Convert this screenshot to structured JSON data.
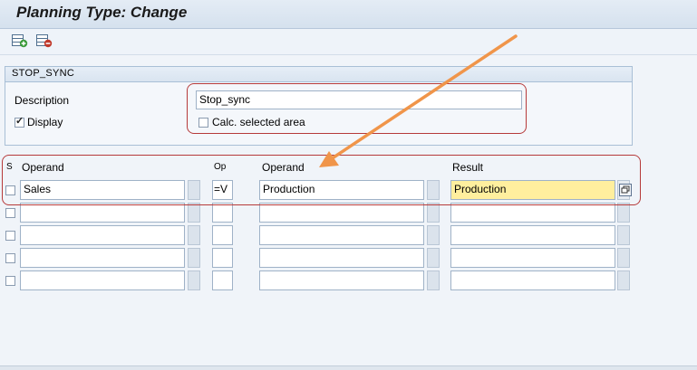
{
  "window": {
    "title": "Planning Type: Change"
  },
  "toolbar": {
    "icons": [
      "add-row-icon",
      "delete-row-icon"
    ]
  },
  "group": {
    "title": "STOP_SYNC",
    "description_label": "Description",
    "description_value": "Stop_sync",
    "display_label": "Display",
    "display_checked": true,
    "calc_label": "Calc. selected area",
    "calc_checked": false
  },
  "table": {
    "headers": {
      "s": "S",
      "operand1": "Operand",
      "op": "Op",
      "operand2": "Operand",
      "result": "Result"
    },
    "rows": [
      {
        "operand1": "Sales",
        "op": "=V",
        "operand2": "Production",
        "result": "Production"
      },
      {
        "operand1": "",
        "op": "",
        "operand2": "",
        "result": ""
      },
      {
        "operand1": "",
        "op": "",
        "operand2": "",
        "result": ""
      },
      {
        "operand1": "",
        "op": "",
        "operand2": "",
        "result": ""
      },
      {
        "operand1": "",
        "op": "",
        "operand2": "",
        "result": ""
      }
    ]
  },
  "annotation": {
    "box_color": "#b63a3a",
    "arrow_color": "#f0954a"
  }
}
